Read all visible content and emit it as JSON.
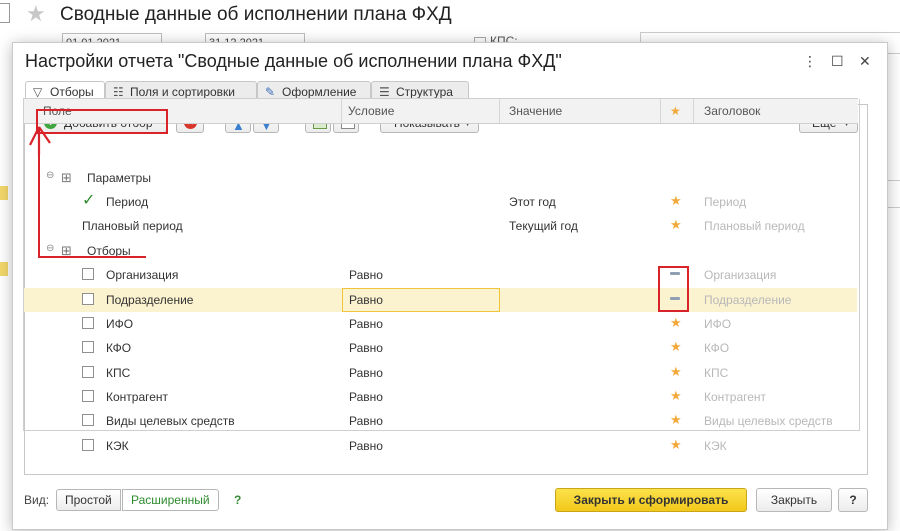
{
  "background": {
    "title": "Сводные данные об исполнении плана ФХД",
    "date_from": "01.01.2021",
    "date_to": "31.12.2021",
    "kps_label": "КПС:"
  },
  "dialog": {
    "title": "Настройки отчета \"Сводные данные об исполнении плана ФХД\"",
    "tabs": [
      {
        "label": "Отборы",
        "icon": "filter-icon"
      },
      {
        "label": "Поля и сортировки",
        "icon": "fields-icon"
      },
      {
        "label": "Оформление",
        "icon": "brush-icon"
      },
      {
        "label": "Структура",
        "icon": "structure-icon"
      }
    ],
    "toolbar": {
      "add_filter": "Добавить отбор",
      "show": "Показывать",
      "more": "Еще"
    },
    "columns": {
      "field": "Поле",
      "condition": "Условие",
      "value": "Значение",
      "title": "Заголовок"
    },
    "groups": {
      "params": "Параметры",
      "filters": "Отборы"
    },
    "param_rows": [
      {
        "field": "Период",
        "value": "Этот год",
        "title": "Период",
        "checked": true
      },
      {
        "field": "Плановый период",
        "value": "Текущий год",
        "title": "Плановый период",
        "checked": false
      }
    ],
    "filter_rows": [
      {
        "field": "Организация",
        "condition": "Равно",
        "title": "Организация",
        "marker": "dash",
        "selected": false
      },
      {
        "field": "Подразделение",
        "condition": "Равно",
        "title": "Подразделение",
        "marker": "dash",
        "selected": true
      },
      {
        "field": "ИФО",
        "condition": "Равно",
        "title": "ИФО",
        "marker": "star",
        "selected": false
      },
      {
        "field": "КФО",
        "condition": "Равно",
        "title": "КФО",
        "marker": "star",
        "selected": false
      },
      {
        "field": "КПС",
        "condition": "Равно",
        "title": "КПС",
        "marker": "star",
        "selected": false
      },
      {
        "field": "Контрагент",
        "condition": "Равно",
        "title": "Контрагент",
        "marker": "star",
        "selected": false
      },
      {
        "field": "Виды целевых средств",
        "condition": "Равно",
        "title": "Виды целевых средств",
        "marker": "star",
        "selected": false
      },
      {
        "field": "КЭК",
        "condition": "Равно",
        "title": "КЭК",
        "marker": "star",
        "selected": false
      }
    ],
    "footer": {
      "view_label": "Вид:",
      "simple": "Простой",
      "extended": "Расширенный",
      "help": "?",
      "close_and_build": "Закрыть и сформировать",
      "close": "Закрыть",
      "help_button": "?"
    }
  },
  "colors": {
    "accent_yellow": "#f2c81b",
    "selection": "#fbf2cf",
    "star": "#f2a93b",
    "annotation_red": "#d8232a",
    "active_green": "#2e8b2e"
  }
}
